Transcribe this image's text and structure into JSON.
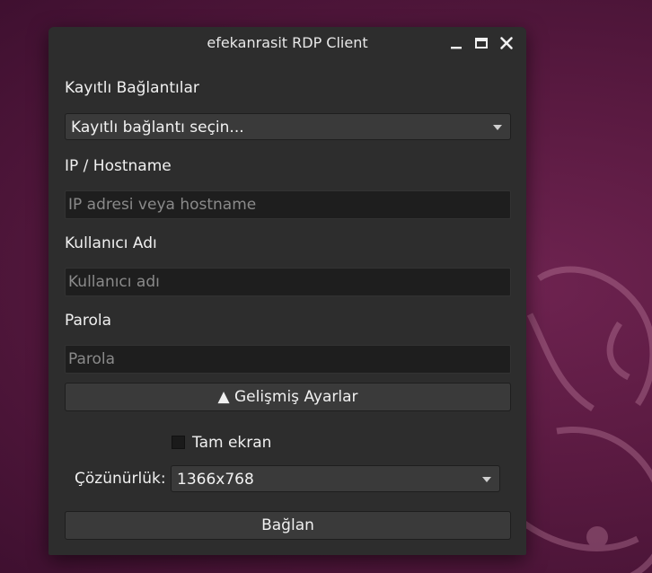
{
  "window": {
    "title": "efekanrasit RDP Client"
  },
  "saved": {
    "label": "Kayıtlı Bağlantılar",
    "selected": "Kayıtlı bağlantı seçin..."
  },
  "host": {
    "label": "IP / Hostname",
    "placeholder": "IP adresi veya hostname",
    "value": ""
  },
  "user": {
    "label": "Kullanıcı Adı",
    "placeholder": "Kullanıcı adı",
    "value": ""
  },
  "password": {
    "label": "Parola",
    "placeholder": "Parola",
    "value": ""
  },
  "advanced": {
    "toggle_label": "▲ Gelişmiş Ayarlar"
  },
  "fullscreen": {
    "label": "Tam ekran",
    "checked": false
  },
  "resolution": {
    "label": "Çözünürlük:",
    "selected": "1366x768"
  },
  "connect": {
    "label": "Bağlan"
  },
  "icons": {
    "minimize": "minimize-icon",
    "maximize": "maximize-icon",
    "close": "close-icon",
    "dropdown": "chevron-down-icon"
  },
  "colors": {
    "window_bg": "#2d2d2d",
    "field_bg": "#1e1e1e",
    "button_bg": "#3a3a3a",
    "desktop_bg": "#5a1a41"
  }
}
